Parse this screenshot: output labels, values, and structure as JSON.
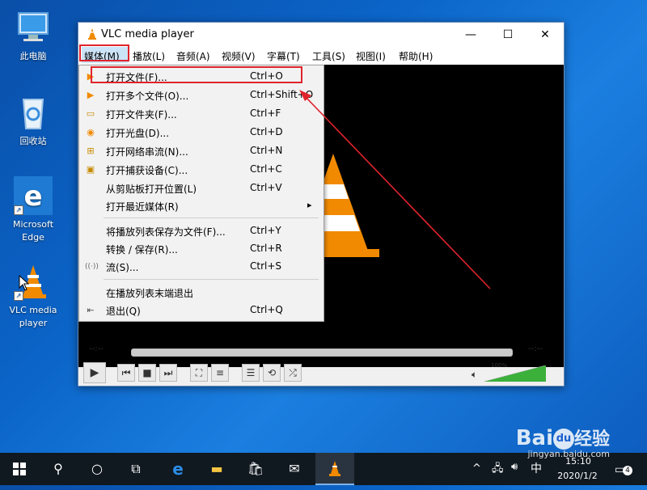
{
  "desktop": {
    "icons": [
      {
        "label": "此电脑"
      },
      {
        "label": "回收站"
      },
      {
        "label_line1": "Microsoft",
        "label_line2": "Edge"
      },
      {
        "label_line1": "VLC media",
        "label_line2": "player"
      }
    ]
  },
  "window": {
    "title": "VLC media player",
    "controls": {
      "minimize": "—",
      "maximize": "☐",
      "close": "✕"
    },
    "menu": [
      "媒体(M)",
      "播放(L)",
      "音频(A)",
      "视频(V)",
      "字幕(T)",
      "工具(S)",
      "视图(I)",
      "帮助(H)"
    ],
    "time_left": "--:--",
    "time_right": "--:--",
    "volume": "100%",
    "volume_level": 1.0
  },
  "media_menu": {
    "items": [
      {
        "label": "打开文件(F)...",
        "shortcut": "Ctrl+O"
      },
      {
        "label": "打开多个文件(O)...",
        "shortcut": "Ctrl+Shift+O"
      },
      {
        "label": "打开文件夹(F)...",
        "shortcut": "Ctrl+F"
      },
      {
        "label": "打开光盘(D)...",
        "shortcut": "Ctrl+D"
      },
      {
        "label": "打开网络串流(N)...",
        "shortcut": "Ctrl+N"
      },
      {
        "label": "打开捕获设备(C)...",
        "shortcut": "Ctrl+C"
      },
      {
        "label": "从剪贴板打开位置(L)",
        "shortcut": "Ctrl+V"
      },
      {
        "label": "打开最近媒体(R)",
        "shortcut": ""
      },
      {
        "label": "将播放列表保存为文件(F)...",
        "shortcut": "Ctrl+Y"
      },
      {
        "label": "转换 / 保存(R)...",
        "shortcut": "Ctrl+R"
      },
      {
        "label": "流(S)...",
        "shortcut": "Ctrl+S"
      },
      {
        "label": "在播放列表末端退出",
        "shortcut": ""
      },
      {
        "label": "退出(Q)",
        "shortcut": "Ctrl+Q"
      }
    ],
    "submenu_arrow": "▸"
  },
  "taskbar": {
    "ime": "中",
    "time": "15:10",
    "date": "2020/1/2",
    "notification_count": "4"
  },
  "watermark": {
    "brand": "Bai",
    "paw": "du",
    "suffix": "经验",
    "url": "jingyan.baidu.com"
  },
  "colors": {
    "accent": "#0078d7",
    "highlight_box": "#e0242c",
    "vlc_orange": "#f18a00"
  }
}
